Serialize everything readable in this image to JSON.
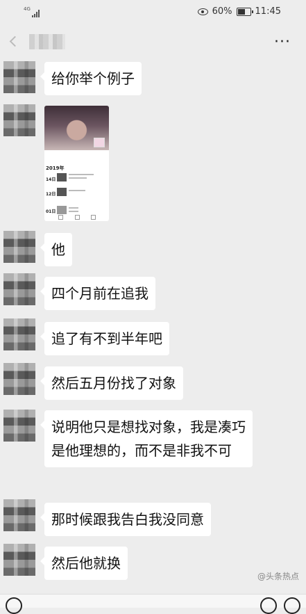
{
  "status_bar": {
    "network": "4G",
    "battery_percent": "60%",
    "time": "11:45"
  },
  "header": {
    "more_label": "···"
  },
  "messages": [
    {
      "type": "text",
      "text": "给你举个例子"
    },
    {
      "type": "image",
      "timeline": {
        "year": "2019年",
        "rows": [
          "14日",
          "12日",
          "01日"
        ]
      }
    },
    {
      "type": "text",
      "text": "他"
    },
    {
      "type": "text",
      "text": "四个月前在追我"
    },
    {
      "type": "text",
      "text": "追了有不到半年吧"
    },
    {
      "type": "text",
      "text": "然后五月份找了对象"
    },
    {
      "type": "text",
      "text": "说明他只是想找对象，我是凑巧是他理想的，而不是非我不可"
    },
    {
      "type": "text",
      "text": "那时候跟我告白我没同意"
    },
    {
      "type": "text",
      "text": "然后他就换"
    }
  ],
  "watermark": "@头条热点"
}
